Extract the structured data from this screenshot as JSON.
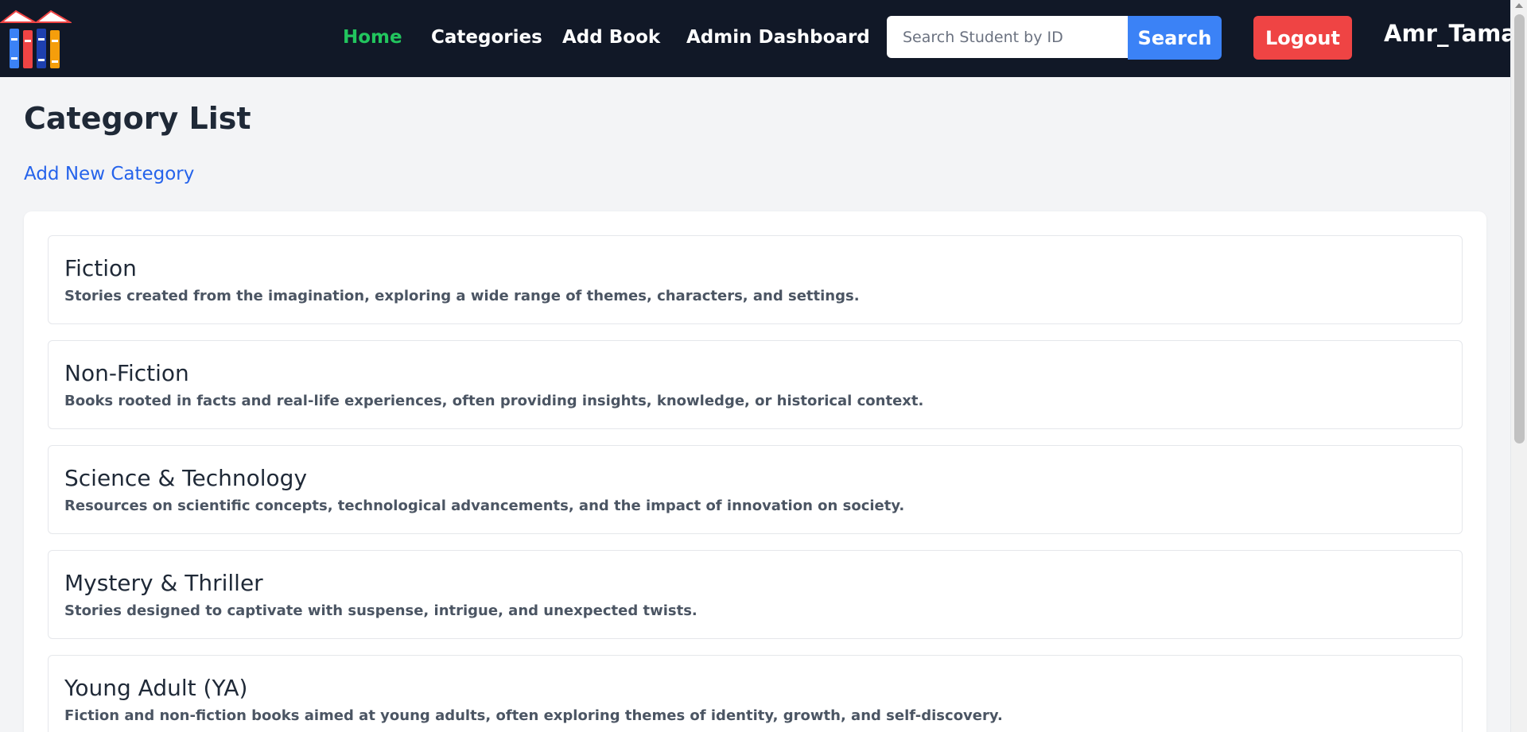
{
  "nav": {
    "links": [
      {
        "label": "Home",
        "active": true
      },
      {
        "label": "Categories",
        "active": false
      },
      {
        "label": "Add Book",
        "active": false
      },
      {
        "label": "Admin Dashboard",
        "active": false
      }
    ],
    "search": {
      "placeholder": "Search Student by ID",
      "value": "",
      "button_label": "Search"
    },
    "logout_label": "Logout",
    "username": "Amr_Taman"
  },
  "colors": {
    "nav_bg": "#111827",
    "active_link": "#22c55e",
    "search_button": "#3b82f6",
    "logout_button": "#ef4444",
    "link_blue": "#2563eb"
  },
  "page": {
    "title": "Category List",
    "add_link": "Add New Category"
  },
  "categories": [
    {
      "name": "Fiction",
      "description": "Stories created from the imagination, exploring a wide range of themes, characters, and settings."
    },
    {
      "name": "Non-Fiction",
      "description": "Books rooted in facts and real-life experiences, often providing insights, knowledge, or historical context."
    },
    {
      "name": "Science & Technology",
      "description": "Resources on scientific concepts, technological advancements, and the impact of innovation on society."
    },
    {
      "name": "Mystery & Thriller",
      "description": "Stories designed to captivate with suspense, intrigue, and unexpected twists."
    },
    {
      "name": "Young Adult (YA)",
      "description": "Fiction and non-fiction books aimed at young adults, often exploring themes of identity, growth, and self-discovery."
    }
  ],
  "icons": {
    "logo": "books-logo-icon",
    "scroll_up": "scroll-up-arrow-icon"
  }
}
